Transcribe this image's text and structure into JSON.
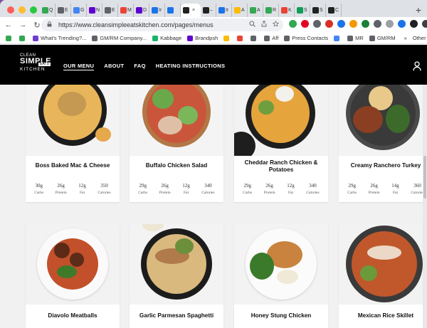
{
  "browser": {
    "tabs": [
      {
        "label": "Q",
        "color": "#34a853"
      },
      {
        "label": "E",
        "color": "#5f6368"
      },
      {
        "label": "G",
        "color": "#4285f4"
      },
      {
        "label": "N",
        "color": "#6001d2"
      },
      {
        "label": "E",
        "color": "#5f6368"
      },
      {
        "label": "M",
        "color": "#ea4335"
      },
      {
        "label": "D",
        "color": "#6001d2"
      },
      {
        "label": "Ir",
        "color": "#1a73e8"
      },
      {
        "label": "",
        "color": "#1a73e8"
      },
      {
        "label": "",
        "color": "#222222",
        "active": true
      },
      {
        "label": "–",
        "color": "#222222"
      },
      {
        "label": "Ir",
        "color": "#1a73e8"
      },
      {
        "label": "A",
        "color": "#fbbc05"
      },
      {
        "label": "A",
        "color": "#34a853"
      },
      {
        "label": "R",
        "color": "#34a853"
      },
      {
        "label": "K",
        "color": "#ea4335"
      },
      {
        "label": "S",
        "color": "#0f9d58"
      },
      {
        "label": "S",
        "color": "#222222"
      },
      {
        "label": "C",
        "color": "#222222"
      }
    ],
    "new_tab": "+",
    "back": "←",
    "forward": "→",
    "reload": "↻",
    "url": "https://www.cleansimpleeatskitchen.com/pages/menus",
    "bookmarks": [
      {
        "label": "",
        "color": "#34a853"
      },
      {
        "label": "",
        "color": "#34a853"
      },
      {
        "label": "What's Trending?...",
        "color": "#6f3bd0"
      },
      {
        "label": "GM/RM Company...",
        "color": "#5f6368"
      },
      {
        "label": "Kabbage",
        "color": "#18b36b"
      },
      {
        "label": "Brandpsh",
        "color": "#6001d2"
      },
      {
        "label": "",
        "color": "#fbbc05"
      },
      {
        "label": "",
        "color": "#ea4335"
      },
      {
        "label": "",
        "color": "#5f6368"
      },
      {
        "label": "Aff",
        "color": "#5f6368"
      },
      {
        "label": "Press Contacts",
        "color": "#5f6368"
      },
      {
        "label": "",
        "color": "#4285f4"
      },
      {
        "label": "MR",
        "color": "#5f6368"
      },
      {
        "label": "GM/RM",
        "color": "#5f6368"
      }
    ],
    "bookmarks_more": "»",
    "other_bookmarks": "Other B"
  },
  "site": {
    "logo": {
      "l1": "CLEAN",
      "l2": "SIMPLE",
      "l3": "EATS",
      "l4": "KITCHEN"
    },
    "nav": [
      {
        "label": "OUR MENU",
        "active": true
      },
      {
        "label": "ABOUT"
      },
      {
        "label": "FAQ"
      },
      {
        "label": "HEATING INSTRUCTIONS"
      }
    ]
  },
  "menu": {
    "macro_labels": [
      "Carbs",
      "Protein",
      "Fat",
      "Calories"
    ],
    "row1": [
      {
        "title": "Boss Baked Mac & Cheese",
        "carbs": "30g",
        "protein": "26g",
        "fat": "12g",
        "calories": "350"
      },
      {
        "title": "Buffalo Chicken Salad",
        "carbs": "29g",
        "protein": "26g",
        "fat": "12g",
        "calories": "340"
      },
      {
        "title": "Cheddar Ranch Chicken & Potatoes",
        "carbs": "29g",
        "protein": "26g",
        "fat": "12g",
        "calories": "340"
      },
      {
        "title": "Creamy Ranchero Turkey",
        "carbs": "29g",
        "protein": "26g",
        "fat": "14g",
        "calories": "360"
      }
    ],
    "row2": [
      {
        "title": "Diavolo Meatballs"
      },
      {
        "title": "Garlic Parmesan Spaghetti"
      },
      {
        "title": "Honey Stung Chicken"
      },
      {
        "title": "Mexican Rice Skillet"
      }
    ]
  }
}
